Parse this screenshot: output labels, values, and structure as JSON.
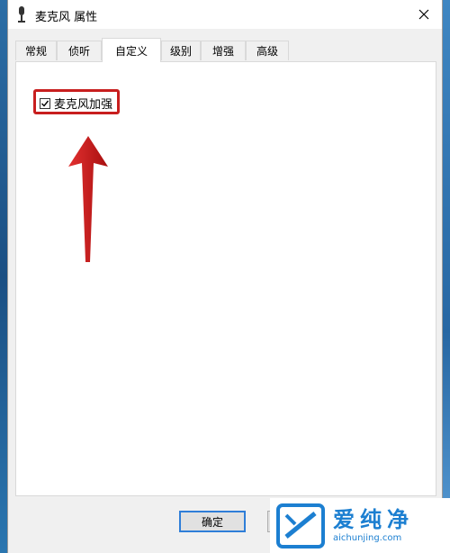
{
  "window": {
    "title": "麦克风 属性",
    "icons": {
      "app": "microphone-icon",
      "close": "close-icon"
    }
  },
  "tabs": [
    {
      "label": "常规",
      "active": false
    },
    {
      "label": "侦听",
      "active": false
    },
    {
      "label": "自定义",
      "active": true
    },
    {
      "label": "级别",
      "active": false
    },
    {
      "label": "增强",
      "active": false
    },
    {
      "label": "高级",
      "active": false
    }
  ],
  "custom_panel": {
    "checkbox_label": "麦克风加强",
    "checked": true
  },
  "buttons": {
    "ok": "确定"
  },
  "annotation": {
    "color": "#c81e1e"
  },
  "watermark": {
    "brand_cn": "爱纯净",
    "site": "aichunjing.com",
    "color": "#1c7fd1"
  }
}
